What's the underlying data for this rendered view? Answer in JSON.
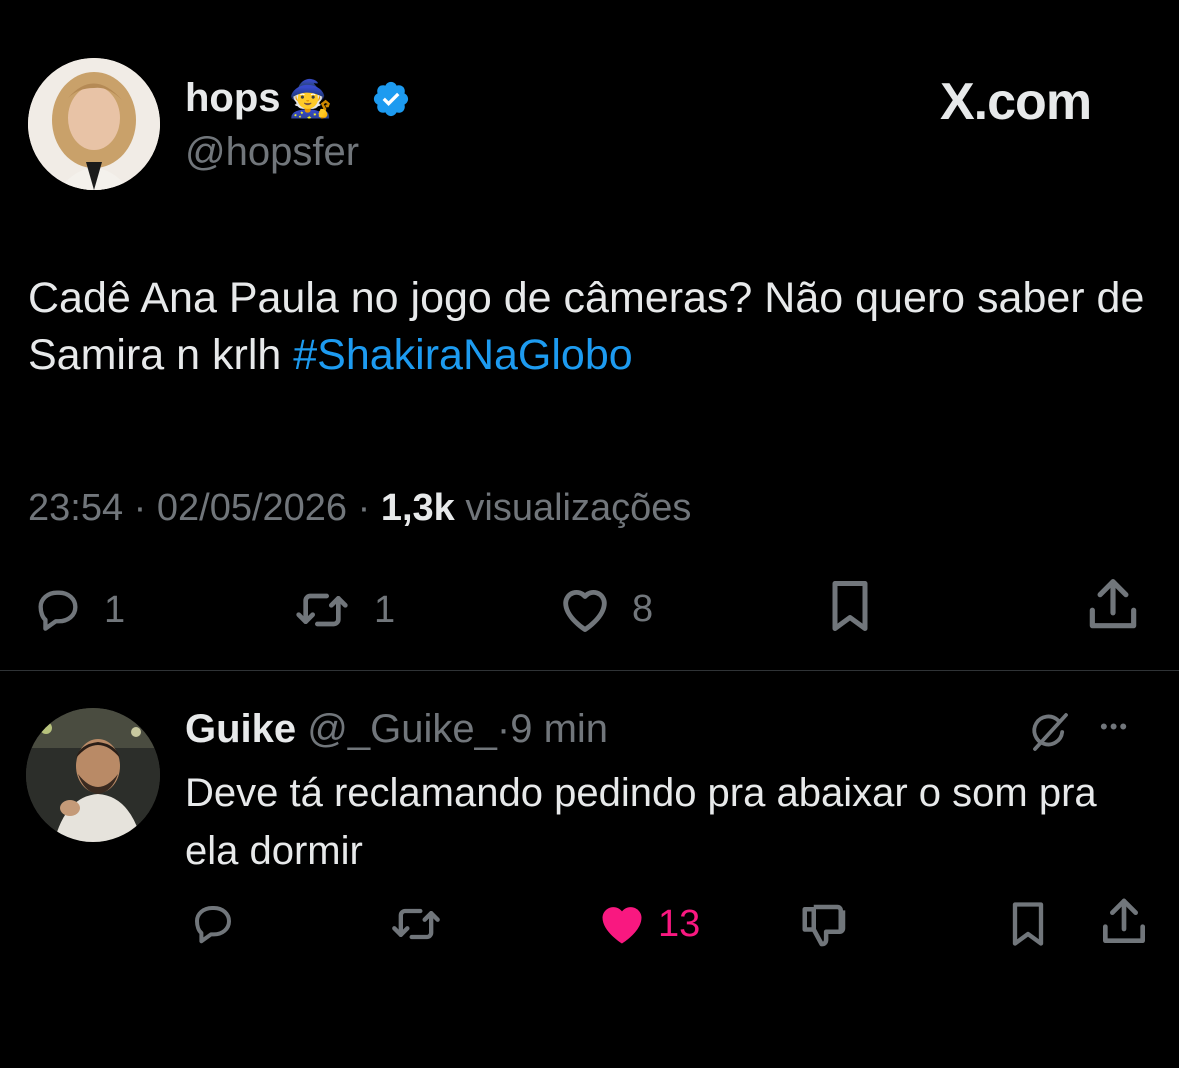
{
  "tweet": {
    "author_name": "hops",
    "author_emoji": "🧙",
    "handle": "@hopsfer",
    "brand": "X.com",
    "text_plain": "Cadê Ana Paula no jogo de câmeras? Não quero saber de Samira n krlh ",
    "hashtag": "#ShakiraNaGlobo",
    "time": "23:54",
    "date": "02/05/2026",
    "views_count": "1,3k",
    "views_label": "visualizações",
    "separator": "·",
    "replies": "1",
    "reposts": "1",
    "likes": "8"
  },
  "reply": {
    "name": "Guike",
    "handle": "@_Guike_",
    "time": "9 min",
    "separator": "·",
    "text": "Deve tá reclamando pedindo pra abaixar o som pra ela dormir",
    "likes": "13",
    "more_label": "•••"
  },
  "colors": {
    "background": "#000000",
    "text": "#e7e9ea",
    "muted": "#71767b",
    "link": "#1d9bf0",
    "like_active": "#f91880",
    "verified": "#1d9bf0"
  }
}
